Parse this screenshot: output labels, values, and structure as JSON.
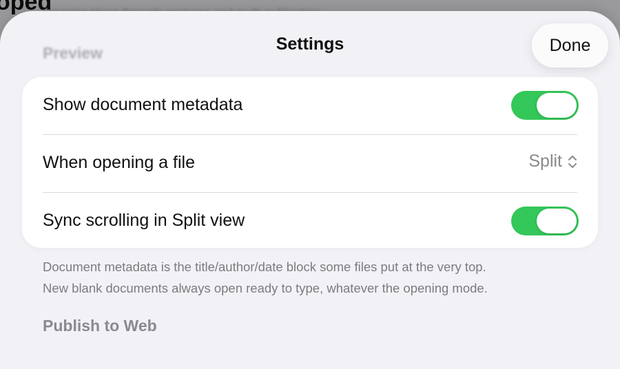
{
  "background": {
    "title": "oped",
    "subtitle": "organize ideas through gestures and multi-publication"
  },
  "sheet": {
    "title": "Settings",
    "done_label": "Done",
    "ghost_section": "Preview"
  },
  "settings": {
    "rows": [
      {
        "label": "Show document metadata",
        "toggle_on": true
      },
      {
        "label": "When opening a file",
        "value": "Split"
      },
      {
        "label": "Sync scrolling in Split view",
        "toggle_on": true
      }
    ],
    "footnote_line1": "Document metadata is the title/author/date block some files put at the very top.",
    "footnote_line2": "New blank documents always open ready to type, whatever the opening mode."
  },
  "next_section": "Publish to Web",
  "colors": {
    "toggle_on": "#34c759",
    "sheet_bg": "#f2f2f6",
    "secondary_text": "#8a8a8e"
  },
  "icons": {
    "picker": "chevron-up-down-icon"
  }
}
